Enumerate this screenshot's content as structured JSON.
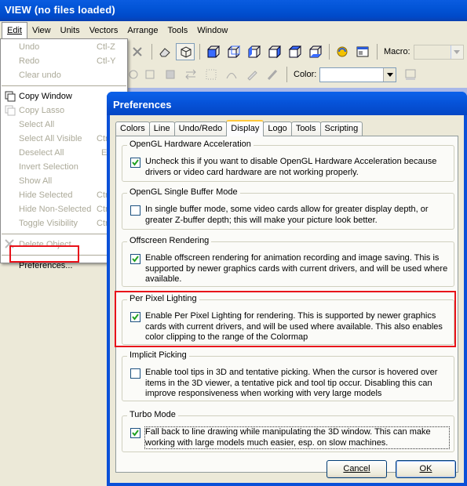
{
  "app": {
    "title": "VIEW (no files loaded)"
  },
  "menubar": [
    "Edit",
    "View",
    "Units",
    "Vectors",
    "Arrange",
    "Tools",
    "Window"
  ],
  "toolbar": {
    "macro_label": "Macro:",
    "color_label": "Color:"
  },
  "edit_menu": {
    "items": [
      {
        "label": "Undo",
        "shortcut": "Ctl-Z",
        "enabled": false
      },
      {
        "label": "Redo",
        "shortcut": "Ctl-Y",
        "enabled": false
      },
      {
        "label": "Clear undo",
        "shortcut": "",
        "enabled": false
      },
      {
        "label": "Copy Window",
        "shortcut": "",
        "enabled": true,
        "icon": "copy-window-icon"
      },
      {
        "label": "Copy Lasso",
        "shortcut": "",
        "enabled": false,
        "icon": "copy-lasso-icon"
      },
      {
        "label": "Select All",
        "shortcut": "",
        "enabled": false
      },
      {
        "label": "Select All Visible",
        "shortcut": "Ctrl",
        "enabled": false
      },
      {
        "label": "Deselect All",
        "shortcut": "E",
        "enabled": false
      },
      {
        "label": "Invert Selection",
        "shortcut": "",
        "enabled": false
      },
      {
        "label": "Show All",
        "shortcut": "",
        "enabled": false
      },
      {
        "label": "Hide Selected",
        "shortcut": "Ctrl",
        "enabled": false
      },
      {
        "label": "Hide Non-Selected",
        "shortcut": "Ctrl",
        "enabled": false
      },
      {
        "label": "Toggle Visibility",
        "shortcut": "Ctrl",
        "enabled": false
      },
      {
        "label": "Delete Object",
        "shortcut": "",
        "enabled": false,
        "icon": "delete-x-icon"
      },
      {
        "label": "Preferences...",
        "shortcut": "",
        "enabled": true
      }
    ]
  },
  "dialog": {
    "title": "Preferences",
    "tabs": [
      "Colors",
      "Line",
      "Undo/Redo",
      "Display",
      "Logo",
      "Tools",
      "Scripting"
    ],
    "active_tab": "Display",
    "groups": [
      {
        "title": "OpenGL Hardware Acceleration",
        "checked": true,
        "text": "Uncheck this if you want to disable OpenGL Hardware Acceleration because drivers or video card hardware are not working properly."
      },
      {
        "title": "OpenGL Single Buffer Mode",
        "checked": false,
        "text": "In single buffer mode, some video cards allow for greater display depth, or greater Z-buffer depth; this will make your picture look better."
      },
      {
        "title": "Offscreen Rendering",
        "checked": true,
        "text": "Enable offscreen rendering for animation recording and image saving. This is supported by newer graphics cards with current drivers, and will be used where available."
      },
      {
        "title": "Per Pixel Lighting",
        "checked": true,
        "text": "Enable Per Pixel Lighting for rendering.  This is supported by newer graphics cards with current drivers, and will be used where available. This also enables color clipping to the range of the Colormap"
      },
      {
        "title": "Implicit Picking",
        "checked": false,
        "text": "Enable tool tips in 3D and tentative picking. When the cursor is hovered over items in the 3D viewer, a tentative pick and tool tip occur. Disabling this can improve responsiveness when working with very large models"
      },
      {
        "title": "Turbo Mode",
        "checked": true,
        "text": "Fall back to line drawing while manipulating the 3D window. This can make working with large models much easier, esp. on slow machines."
      }
    ],
    "cancel_label": "Cancel",
    "ok_label": "OK"
  },
  "colors": {
    "highlight": "#e8121a",
    "xp_blue": "#0a50d8"
  }
}
